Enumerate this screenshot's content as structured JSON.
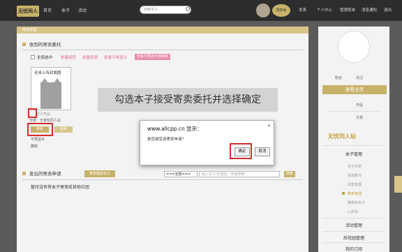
{
  "logo": "无忧同人",
  "nav": [
    "首页",
    "本子",
    "活动"
  ],
  "search": {
    "placeholder": "搜索本子..."
  },
  "top_badge": "同好会",
  "top_menu": [
    "发表",
    "个人中心",
    "管理菜单",
    "消息通知",
    "退出"
  ],
  "page_header": "寄卖管理",
  "received": {
    "title": "收到的寄卖委托",
    "select_all": "全部选中",
    "batch_accept": "批量接受",
    "batch_reject": "批量拒绝",
    "batch_hide": "批量不再显示",
    "show_hidden": "查看不再显示的寄卖"
  },
  "item": {
    "upload_label": "还未上传封面图",
    "caption": "本子作品",
    "author": "作者：无意知同人站",
    "accept": "接受",
    "reject": "拒绝",
    "hide": "不再显示",
    "delete": "删除"
  },
  "sent": {
    "title": "发出的寄卖申请",
    "my_button": "寄卖我的本子",
    "select": "===全部===",
    "input_placeholder": "输入本子/社团名，快速搜索",
    "search_btn": "搜索",
    "empty": "暂时没有将本子寄卖给其他社团"
  },
  "overlay": "勾选本子接受寄卖委托并选择确定",
  "dialog": {
    "title": "www.allcpp.cn 显示：",
    "message": "是否接受该寄卖申请？",
    "ok": "确定",
    "cancel": "取消",
    "close": "✕"
  },
  "profile": {
    "stat1_label": "粉丝",
    "stat2_label": "关注",
    "view_btn": "查看主页",
    "works_label": "作品",
    "articles_label": "文章"
  },
  "side_logo": "无忧同人站",
  "side_menu": {
    "books_header": "本子管理",
    "items": [
      "本子列表",
      "添加新刊",
      "出售管理",
      "寄卖管理",
      "推荐的本子",
      "心愿单"
    ],
    "activity": "活动管理",
    "garden": "后花园管理",
    "orders": "我的订阅"
  }
}
